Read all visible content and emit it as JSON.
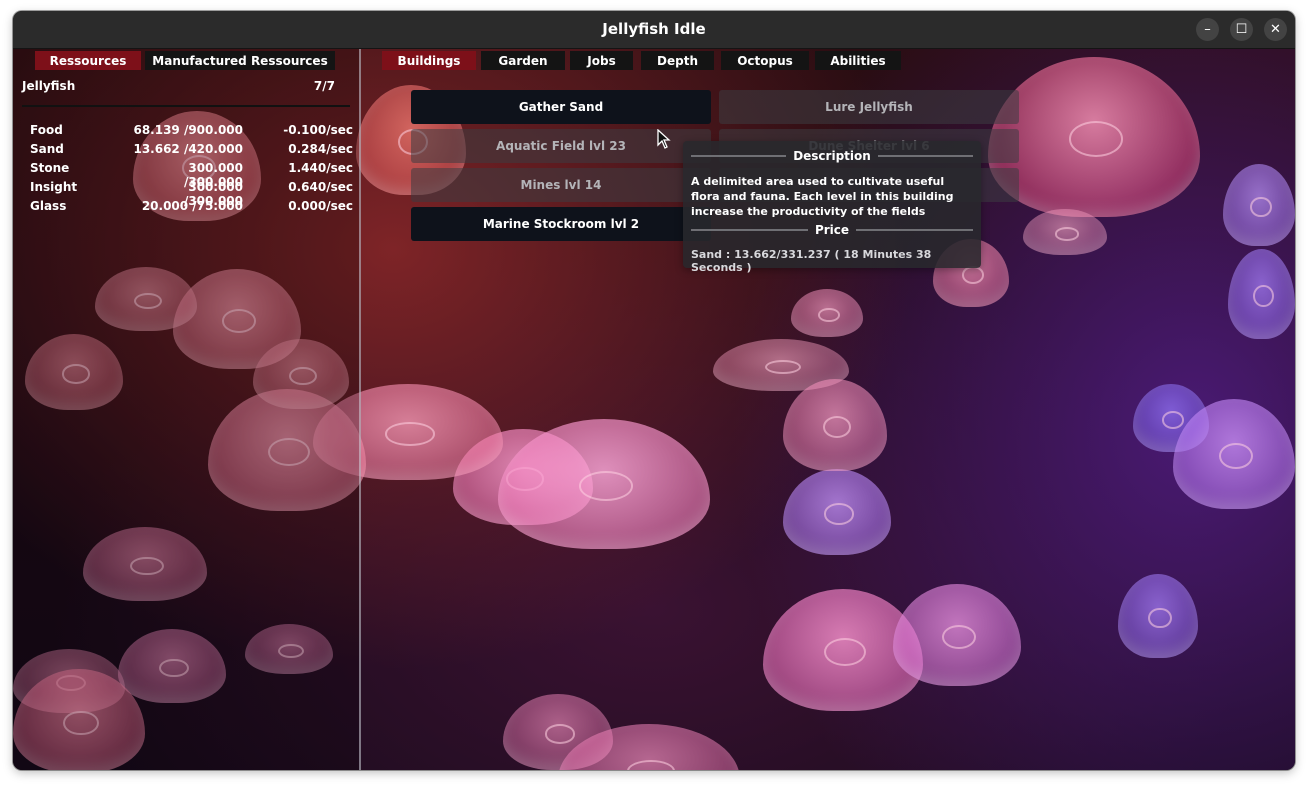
{
  "window": {
    "title": "Jellyfish Idle",
    "minimize_glyph": "–",
    "maximize_glyph": "☐",
    "close_glyph": "✕"
  },
  "left_tabs": [
    {
      "label": "Ressources",
      "active": true
    },
    {
      "label": "Manufactured Ressources",
      "active": false
    }
  ],
  "jellyfish": {
    "label": "Jellyfish",
    "count": "7/7"
  },
  "resources": [
    {
      "name": "Food",
      "amount": "68.139 /900.000",
      "rate": "-0.100/sec"
    },
    {
      "name": "Sand",
      "amount": "13.662 /420.000",
      "rate": "0.284/sec"
    },
    {
      "name": "Stone",
      "amount": "300.000 /300.000",
      "rate": "1.440/sec"
    },
    {
      "name": "Insight",
      "amount": "300.000 /300.000",
      "rate": "0.640/sec"
    },
    {
      "name": "Glass",
      "amount": "20.000 /75.000",
      "rate": "0.000/sec"
    }
  ],
  "main_tabs": [
    {
      "label": "Buildings",
      "active": true
    },
    {
      "label": "Garden",
      "active": false
    },
    {
      "label": "Jobs",
      "active": false
    },
    {
      "label": "Depth",
      "active": false
    },
    {
      "label": "Octopus",
      "active": false
    },
    {
      "label": "Abilities",
      "active": false
    }
  ],
  "buildings": [
    {
      "label": "Gather Sand",
      "enabled": true
    },
    {
      "label": "Lure Jellyfish",
      "enabled": false
    },
    {
      "label": "Aquatic Field lvl 23",
      "enabled": false
    },
    {
      "label": "Dune Shelter lvl 6",
      "enabled": false
    },
    {
      "label": "Mines lvl 14",
      "enabled": false
    },
    {
      "label": "Marine Stockroom lvl 2",
      "enabled": true
    }
  ],
  "tooltip": {
    "description_heading": "Description",
    "description": "A delimited area used to cultivate useful flora and fauna. Each level in this building increase the productivity of the fields",
    "price_heading": "Price",
    "price": "Sand : 13.662/331.237  ( 18 Minutes 38 Seconds )"
  },
  "colors": {
    "active_tab": "#7d1019",
    "inactive_tab": "#141414",
    "enabled_button": "#0e121b",
    "titlebar": "#2b2b2b"
  },
  "icons": [
    "minimize-icon",
    "maximize-icon",
    "close-icon",
    "mouse-cursor-icon"
  ]
}
